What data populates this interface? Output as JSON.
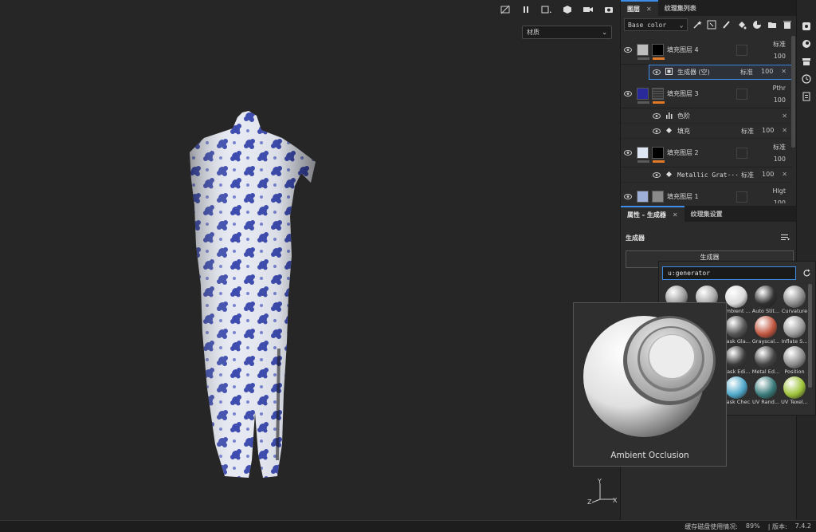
{
  "viewport": {
    "material_select": {
      "label": "材质"
    }
  },
  "layers_panel": {
    "tabs": [
      {
        "label": "图层",
        "closable": true
      },
      {
        "label": "纹理集列表",
        "closable": false
      }
    ],
    "channel": "Base color",
    "rows": [
      {
        "name": "填充图层 4",
        "blend": "标准",
        "opacity": "100",
        "thumb_color": "#bdbdbd",
        "mask_color": "#000000"
      },
      {
        "name": "生成器 (空)",
        "blend": "标准",
        "opacity": "100",
        "sub": true,
        "selected": true
      },
      {
        "name": "填充图层 3",
        "blend": "Pthr",
        "opacity": "100",
        "thumb_color": "#2a2a9a",
        "mask_color": "#3a3a3a"
      },
      {
        "name": "色阶",
        "sub": true
      },
      {
        "name": "填充",
        "blend": "标准",
        "opacity": "100",
        "sub": true
      },
      {
        "name": "填充图层 2",
        "blend": "标准",
        "opacity": "100",
        "thumb_color": "#dde6f2",
        "mask_color": "#000000"
      },
      {
        "name": "Metallic Grat···",
        "blend": "标准",
        "opacity": "100",
        "sub": true
      },
      {
        "name": "填充图层 1",
        "blend": "Hlgt",
        "opacity": "100",
        "thumb_color": "#9fb0d8",
        "mask_color": "#8a8a8a"
      }
    ]
  },
  "properties_panel": {
    "tabs": [
      {
        "label": "属性 - 生成器",
        "closable": true
      },
      {
        "label": "纹理集设置",
        "closable": false
      }
    ],
    "section_title": "生成器",
    "generator_button": "生成器"
  },
  "generator_picker": {
    "search_value": "u:generator",
    "items": [
      {
        "label": "",
        "color": "#9a9a9a"
      },
      {
        "label": "",
        "color": "#a8a8a8"
      },
      {
        "label": "Ambient ...",
        "color": "#d9d9d9"
      },
      {
        "label": "Auto Stit...",
        "color": "#2f2f2f"
      },
      {
        "label": "Curvature",
        "color": "#8a8a8a"
      },
      {
        "label": "",
        "color": "#777777"
      },
      {
        "label": "",
        "color": "#6e6e6e"
      },
      {
        "label": "Mask Gla...",
        "color": "#555555"
      },
      {
        "label": "Grayscal...",
        "color": "#c0563f"
      },
      {
        "label": "Inflate S...",
        "color": "#9a9a9a"
      },
      {
        "label": "",
        "color": "#666666"
      },
      {
        "label": "",
        "color": "#707070"
      },
      {
        "label": "Mask Edi...",
        "color": "#3a3a3a"
      },
      {
        "label": "Metal Ed...",
        "color": "#444444"
      },
      {
        "label": "Position",
        "color": "#8d8d8d"
      },
      {
        "label": "",
        "color": "#5a5a5a"
      },
      {
        "label": "",
        "color": "#5f5f5f"
      },
      {
        "label": "Mask Chec...",
        "color": "#4fa7c9"
      },
      {
        "label": "UV Rand...",
        "color": "#3a7a7a"
      },
      {
        "label": "UV Texel...",
        "color": "#9ec23a"
      }
    ]
  },
  "preview": {
    "label": "Ambient Occlusion"
  },
  "status_bar": {
    "cache_label": "缓存磁盘使用情况:",
    "cache_value": "89%",
    "version_label": "| 版本:",
    "version_value": "7.4.2"
  },
  "axis": {
    "y": "Y",
    "z": "Z",
    "x": "X"
  }
}
